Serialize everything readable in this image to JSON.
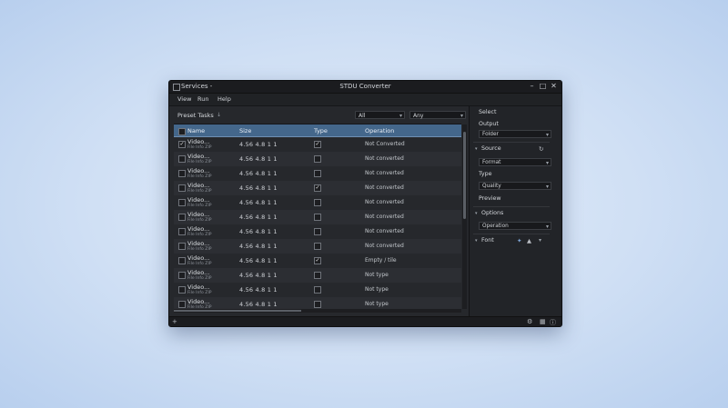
{
  "window": {
    "app_title": "Services -",
    "title": "STDU Converter",
    "controls": {
      "minimize": "–",
      "maximize": "□",
      "close": "✕"
    }
  },
  "menubar": [
    "View",
    "Run",
    "Help"
  ],
  "toolbar": {
    "label": "Preset Tasks",
    "arrow": "↓",
    "select1": "All",
    "select2": "Any"
  },
  "table": {
    "headers": [
      "Name",
      "Size",
      "Type",
      "Operation"
    ],
    "rows": [
      {
        "checked": true,
        "name": "Video...",
        "sub": "File Info ZIP",
        "size": "4.56 4.8 1 1",
        "checked2": true,
        "fmt": "",
        "status": "Not Converted"
      },
      {
        "checked": false,
        "name": "Video...",
        "sub": "File Info ZIP",
        "size": "4.56 4.8 1 1",
        "checked2": false,
        "fmt": "",
        "status": "Not converted"
      },
      {
        "checked": false,
        "name": "Video...",
        "sub": "File Info ZIP",
        "size": "4.56 4.8 1 1",
        "checked2": false,
        "fmt": "",
        "status": "Not converted"
      },
      {
        "checked": false,
        "name": "Video...",
        "sub": "File Info ZIP",
        "size": "4.56 4.8 1 1",
        "checked2": true,
        "fmt": "",
        "status": "Not converted"
      },
      {
        "checked": false,
        "name": "Video...",
        "sub": "File Info ZIP",
        "size": "4.56 4.8 1 1",
        "checked2": false,
        "fmt": "",
        "status": "Not converted"
      },
      {
        "checked": false,
        "name": "Video...",
        "sub": "File Info ZIP",
        "size": "4.56 4.8 1 1",
        "checked2": false,
        "fmt": "",
        "status": "Not converted"
      },
      {
        "checked": false,
        "name": "Video...",
        "sub": "File Info ZIP",
        "size": "4.56 4.8 1 1",
        "checked2": false,
        "fmt": "",
        "status": "Not converted"
      },
      {
        "checked": false,
        "name": "Video...",
        "sub": "File Info ZIP",
        "size": "4.56 4.8 1 1",
        "checked2": false,
        "fmt": "",
        "status": "Not converted"
      },
      {
        "checked": false,
        "name": "Video...",
        "sub": "File Info ZIP",
        "size": "4.56 4.8 1 1",
        "checked2": true,
        "fmt": "",
        "status": "Empty / tile"
      },
      {
        "checked": false,
        "name": "Video...",
        "sub": "File Info ZIP",
        "size": "4.56 4.8 1 1",
        "checked2": false,
        "fmt": "",
        "status": "Not type"
      },
      {
        "checked": false,
        "name": "Video...",
        "sub": "File Info ZIP",
        "size": "4.56 4.8 1 1",
        "checked2": false,
        "fmt": "",
        "status": "Not type"
      },
      {
        "checked": false,
        "name": "Video...",
        "sub": "File Info ZIP",
        "size": "4.56 4.8 1 1",
        "checked2": false,
        "fmt": "",
        "status": "Not type"
      }
    ]
  },
  "sidebar": {
    "title": "Select",
    "output_label": "Output",
    "output_value": "Folder",
    "source_section": "Source",
    "format_value": "Format",
    "type_label": "Type",
    "quality_value": "Quality",
    "preview_label": "Preview",
    "options_section": "Options",
    "operation_value": "Operation",
    "font_section": "Font"
  },
  "statusbar": {
    "add": "+",
    "settings": "⚙",
    "grid": "▦",
    "info": "ⓘ"
  }
}
